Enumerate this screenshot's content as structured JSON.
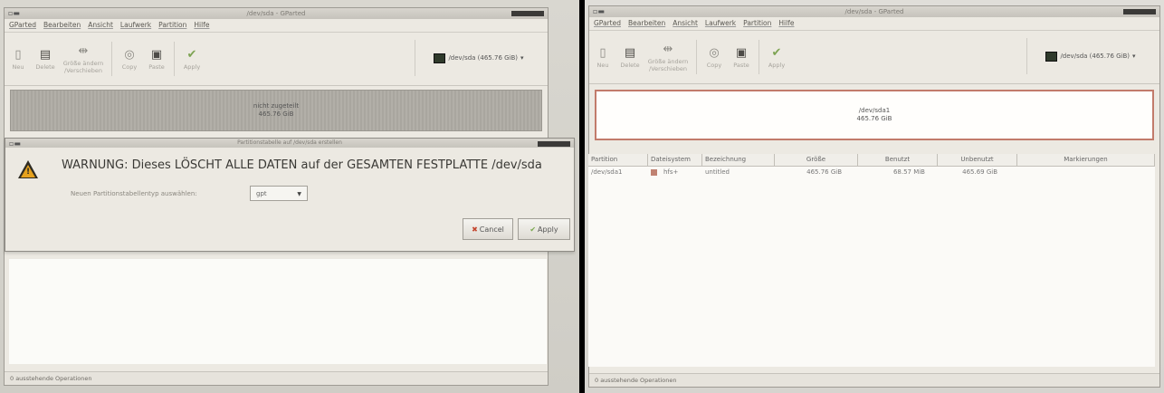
{
  "menu": [
    "GParted",
    "Bearbeiten",
    "Ansicht",
    "Laufwerk",
    "Partition",
    "Hilfe"
  ],
  "window": {
    "title": "/dev/sda - GParted",
    "controls_icon": "window-controls-icon"
  },
  "toolbar": {
    "new": "Neu",
    "delete": "Delete",
    "resize_line1": "Größe ändern",
    "resize_line2": "/Verschieben",
    "copy": "Copy",
    "paste": "Paste",
    "apply": "Apply"
  },
  "device": {
    "label": "/dev/sda  (465.76 GiB)",
    "arrow": "▾"
  },
  "left_panel": {
    "graph_line1": "nicht zugeteilt",
    "graph_line2": "465.76 GiB",
    "status": "0 ausstehende Operationen",
    "dialog": {
      "title": "Partitionstabelle auf /dev/sda erstellen",
      "warning": "WARNUNG:  Dieses LÖSCHT ALLE DATEN auf der GESAMTEN FESTPLATTE /dev/sda",
      "type_label": "Neuen Partitionstabellentyp auswählen:",
      "type_value": "gpt",
      "cancel": "Cancel",
      "apply": "Apply"
    }
  },
  "right_panel": {
    "graph_line1": "/dev/sda1",
    "graph_line2": "465.76 GiB",
    "status": "0 ausstehende Operationen",
    "columns": [
      "Partition",
      "Dateisystem",
      "Bezeichnung",
      "Größe",
      "Benutzt",
      "Unbenutzt",
      "Markierungen"
    ],
    "rows": [
      {
        "partition": "/dev/sda1",
        "filesystem": "hfs+",
        "label": "untitled",
        "size": "465.76 GiB",
        "used": "68.57 MiB",
        "unused": "465.69 GiB",
        "flags": ""
      }
    ]
  },
  "colors": {
    "fs_hfs": "#c08272",
    "graph_border": "#c27b6b",
    "warn": "#e6a21e"
  }
}
